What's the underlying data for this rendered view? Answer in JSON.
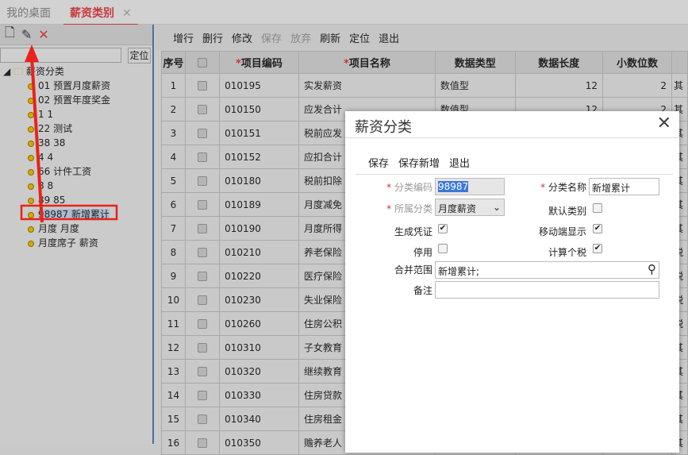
{
  "tabs": [
    {
      "label": "我的桌面"
    },
    {
      "label": "薪资类别",
      "close": "✕"
    }
  ],
  "left": {
    "locate_label": "定位",
    "root": "薪资分类",
    "items": [
      "01 预置月度薪资",
      "02 预置年度奖金",
      "1 1",
      "22 测试",
      "38 38",
      "4 4",
      "66 计件工资",
      "8 8",
      "89 85",
      "98987 新增累计",
      "月度 月度",
      "月度席子 薪资"
    ],
    "selected_index": 9
  },
  "toolbar": [
    "增行",
    "删行",
    "修改",
    "保存",
    "放弃",
    "刷新",
    "定位",
    "退出"
  ],
  "table": {
    "headers": [
      "序号",
      "",
      "项目编码",
      "项目名称",
      "数据类型",
      "数据长度",
      "小数位数",
      ""
    ],
    "rows": [
      [
        "1",
        "010195",
        "实发薪资",
        "数值型",
        "12",
        "2",
        "其"
      ],
      [
        "2",
        "010150",
        "应发合计",
        "数值型",
        "12",
        "2",
        "其"
      ],
      [
        "3",
        "010151",
        "税前应发",
        "",
        "",
        "",
        "其"
      ],
      [
        "4",
        "010152",
        "应扣合计",
        "",
        "",
        "",
        "其"
      ],
      [
        "5",
        "010180",
        "税前扣除",
        "",
        "",
        "",
        "其"
      ],
      [
        "6",
        "010189",
        "月度减免",
        "",
        "",
        "",
        "其"
      ],
      [
        "7",
        "010190",
        "月度所得",
        "",
        "",
        "",
        "其"
      ],
      [
        "8",
        "010210",
        "养老保险",
        "",
        "",
        "",
        "税"
      ],
      [
        "9",
        "010220",
        "医疗保险",
        "",
        "",
        "",
        "税"
      ],
      [
        "10",
        "010230",
        "失业保险",
        "",
        "",
        "",
        "税"
      ],
      [
        "11",
        "010260",
        "住房公积",
        "",
        "",
        "",
        "税"
      ],
      [
        "12",
        "010310",
        "子女教育",
        "",
        "",
        "",
        "其"
      ],
      [
        "13",
        "010320",
        "继续教育",
        "",
        "",
        "",
        "其"
      ],
      [
        "14",
        "010330",
        "住房贷款",
        "",
        "",
        "",
        "其"
      ],
      [
        "15",
        "010340",
        "住房租金",
        "",
        "",
        "",
        "其"
      ],
      [
        "16",
        "010350",
        "赡养老人",
        "",
        "",
        "",
        "其"
      ]
    ]
  },
  "modal": {
    "title": "薪资分类",
    "close": "✕",
    "buttons": [
      "保存",
      "保存新增",
      "退出"
    ],
    "code_label": "分类编码",
    "code_value": "98987",
    "name_label": "分类名称",
    "name_value": "新增累计",
    "parent_label": "所属分类",
    "parent_value": "月度薪资",
    "default_label": "默认类别",
    "voucher_label": "生成凭证",
    "mobile_label": "移动端显示",
    "disabled_label": "停用",
    "tax_label": "计算个税",
    "merge_label": "合并范围",
    "merge_value": "新增累计;",
    "remark_label": "备注",
    "remark_value": "",
    "checks": {
      "default": false,
      "voucher": true,
      "mobile": true,
      "disabled": false,
      "tax": true
    }
  },
  "colors": {
    "accent": "#c8393f",
    "annotation": "#e8231b"
  }
}
